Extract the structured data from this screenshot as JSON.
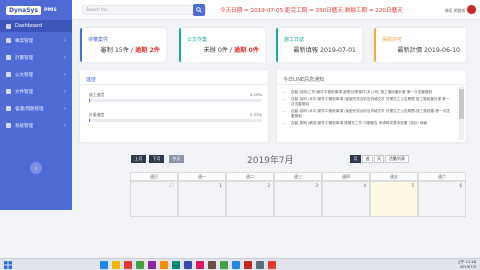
{
  "app": {
    "logo": "DynaSys",
    "logo_sub": "PMIS",
    "dashboard": "Dashboard"
  },
  "sidebar": {
    "items": [
      {
        "label": "專案管理"
      },
      {
        "label": "計畫管理"
      },
      {
        "label": "公文管理"
      },
      {
        "label": "文件管理"
      },
      {
        "label": "會議/問題管理"
      },
      {
        "label": "系統管理"
      }
    ],
    "collapse_icon": "‹"
  },
  "topbar": {
    "search_placeholder": "Search for...",
    "marquee": "今天日期 = 2019-07-05 距完工期 = 350日曆天 剩餘工期 = 220日曆天",
    "username": "陳家 網路報",
    "search_icon": "search-icon"
  },
  "cards": [
    {
      "title": "待審案件",
      "value_prefix": "審制 15件 / ",
      "value_red": "逾期 2件",
      "color": "#4f6bd6"
    },
    {
      "title": "公文作業",
      "value_prefix": "未辦 0件 / ",
      "value_red": "逾期 0件",
      "color": "#26a69a"
    },
    {
      "title": "施工日誌",
      "value_prefix": "最新填報 2019-07-01",
      "value_red": "",
      "color": "#26a69a"
    },
    {
      "title": "保險許可",
      "value_prefix": "最新計價 2019-06-10",
      "value_red": "",
      "color": "#f0ad4e"
    }
  ],
  "progress": {
    "title": "進度",
    "items": [
      {
        "label": "施工進度",
        "percent": "0.29%",
        "value": 0.29
      },
      {
        "label": "計畫進度",
        "percent": "0.33%",
        "value": 0.33
      }
    ]
  },
  "notices": {
    "title": "今日LINE訊息通知",
    "items": [
      "自動-說明(工作)案件中管制事項 處理/回覆案件(本公司) 施工階段審計畫-第一次送審管制",
      "自動-說明 (本中)案件中管制事項 /保固完成合約及資格文件 所需交之公告期間 施工階段審計畫 第一次送審管制",
      "自動-說明 (本中)案件中管制事項 /保固完成合約及資格文件 所需交之公告期間-施工階段審-第一次送審管制",
      "自動-周期 (轉流)案件中管制事項 請補充工作 中期報告 申請時或基本設置 (項目) 填報"
    ]
  },
  "calendar": {
    "buttons": {
      "prev": "上月",
      "next": "下月",
      "today": "今天",
      "month": "月",
      "week": "週",
      "day": "天",
      "list": "活動列表"
    },
    "title": "2019年7月",
    "weekdays": [
      "週日",
      "週一",
      "週二",
      "週三",
      "週四",
      "週五",
      "週六"
    ],
    "days": [
      "27",
      "1",
      "2",
      "3",
      "4",
      "5",
      "6"
    ]
  },
  "taskbar": {
    "time": "上午 11:18",
    "date": "2019/7/5"
  }
}
